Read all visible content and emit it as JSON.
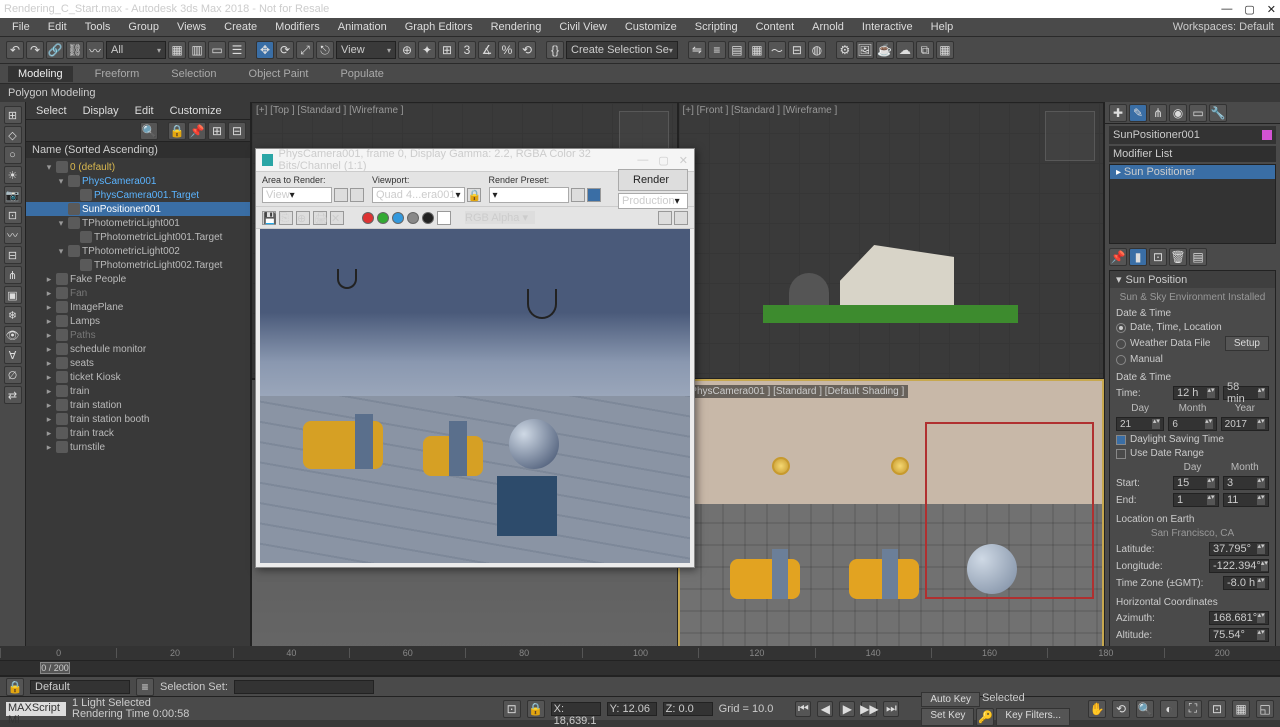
{
  "title": "Rendering_C_Start.max - Autodesk 3ds Max 2018 - Not for Resale",
  "menus": [
    "File",
    "Edit",
    "Tools",
    "Group",
    "Views",
    "Create",
    "Modifiers",
    "Animation",
    "Graph Editors",
    "Rendering",
    "Civil View",
    "Customize",
    "Scripting",
    "Content",
    "Arnold",
    "Interactive",
    "Help"
  ],
  "workspaces_label": "Workspaces: Default",
  "toolbar": {
    "all": "All",
    "view": "View",
    "selset": "Create Selection Se"
  },
  "ribbon": {
    "tabs": [
      "Modeling",
      "Freeform",
      "Selection",
      "Object Paint",
      "Populate"
    ],
    "sub": "Polygon Modeling"
  },
  "scene": {
    "menus": [
      "Select",
      "Display",
      "Edit",
      "Customize"
    ],
    "header": "Name (Sorted Ascending)",
    "nodes": [
      {
        "lbl": "0 (default)",
        "d": 1,
        "cls": "gold",
        "tw": "▾"
      },
      {
        "lbl": "PhysCamera001",
        "d": 2,
        "cls": "blue",
        "tw": "▾"
      },
      {
        "lbl": "PhysCamera001.Target",
        "d": 3,
        "cls": "blue"
      },
      {
        "lbl": "SunPositioner001",
        "d": 2,
        "cls": "sel"
      },
      {
        "lbl": "TPhotometricLight001",
        "d": 2,
        "cls": "",
        "tw": "▾"
      },
      {
        "lbl": "TPhotometricLight001.Target",
        "d": 3,
        "cls": ""
      },
      {
        "lbl": "TPhotometricLight002",
        "d": 2,
        "cls": "",
        "tw": "▾"
      },
      {
        "lbl": "TPhotometricLight002.Target",
        "d": 3,
        "cls": ""
      },
      {
        "lbl": "Fake People",
        "d": 1,
        "tw": "▸"
      },
      {
        "lbl": "Fan",
        "d": 1,
        "cls": "dim",
        "tw": "▸"
      },
      {
        "lbl": "ImagePlane",
        "d": 1,
        "tw": "▸"
      },
      {
        "lbl": "Lamps",
        "d": 1,
        "tw": "▸"
      },
      {
        "lbl": "Paths",
        "d": 1,
        "cls": "dim",
        "tw": "▸"
      },
      {
        "lbl": "schedule monitor",
        "d": 1,
        "tw": "▸"
      },
      {
        "lbl": "seats",
        "d": 1,
        "tw": "▸"
      },
      {
        "lbl": "ticket Kiosk",
        "d": 1,
        "tw": "▸"
      },
      {
        "lbl": "train",
        "d": 1,
        "tw": "▸"
      },
      {
        "lbl": "train station",
        "d": 1,
        "tw": "▸"
      },
      {
        "lbl": "train station booth",
        "d": 1,
        "tw": "▸"
      },
      {
        "lbl": "train track",
        "d": 1,
        "tw": "▸"
      },
      {
        "lbl": "turnstile",
        "d": 1,
        "tw": "▸"
      }
    ]
  },
  "vp": {
    "tl": "[+] [Top ] [Standard ] [Wireframe ]",
    "tr": "[+] [Front ] [Standard ] [Wireframe ]",
    "br": "[PhysCamera001 ] [Standard ] [Default Shading ]"
  },
  "rfw": {
    "title": "PhysCamera001, frame 0, Display Gamma: 2.2, RGBA Color 32 Bits/Channel (1:1)",
    "area_lbl": "Area to Render:",
    "area_val": "View",
    "vp_lbl": "Viewport:",
    "vp_val": "Quad 4...era001",
    "preset_lbl": "Render Preset:",
    "preset_val": "",
    "prod": "Production",
    "render": "Render",
    "alpha": "RGB Alpha"
  },
  "cmd": {
    "name": "SunPositioner001",
    "modlist": "Modifier List",
    "stack": "Sun Positioner",
    "roll1": "Sun Position",
    "env": "Sun & Sky Environment Installed",
    "dt_hdr": "Date & Time",
    "r1": "Date, Time, Location",
    "r2": "Weather Data File",
    "r3": "Manual",
    "setup": "Setup",
    "dt2": "Date & Time",
    "time": "Time:",
    "h": "12 h",
    "m": "58 min",
    "cols": [
      "Day",
      "Month",
      "Year"
    ],
    "dvals": [
      "21",
      "6",
      "2017"
    ],
    "dst": "Daylight Saving Time",
    "udr": "Use Date Range",
    "cols2": [
      "Day",
      "Month"
    ],
    "start": "Start:",
    "svals": [
      "15",
      "3"
    ],
    "end": "End:",
    "evals": [
      "1",
      "11"
    ],
    "loc": "Location on Earth",
    "city": "San Francisco, CA",
    "lat": "Latitude:",
    "latv": "37.795°",
    "lon": "Longitude:",
    "lonv": "-122.394°",
    "tz": "Time Zone (±GMT):",
    "tzv": "-8.0 h",
    "hc": "Horizontal Coordinates",
    "az": "Azimuth:",
    "azv": "168.681°",
    "alt": "Altitude:",
    "altv": "75.54°"
  },
  "track": {
    "pos": "0 / 200"
  },
  "status": {
    "default": "Default",
    "selset": "Selection Set:",
    "sel": "1 Light Selected",
    "rtime": "Rendering Time  0:00:58",
    "maxscript": "MAXScript Mi"
  },
  "coords": {
    "x": "X: 18,639.1",
    "y": "Y: 12.06",
    "z": "Z: 0.0",
    "grid": "Grid = 10.0"
  },
  "right_status": {
    "autokey": "Auto Key",
    "selected": "Selected",
    "setkey": "Set Key",
    "keyf": "Key Filters..."
  },
  "ticks": [
    "0",
    "20",
    "40",
    "60",
    "80",
    "100",
    "120",
    "140",
    "160",
    "180",
    "200"
  ]
}
